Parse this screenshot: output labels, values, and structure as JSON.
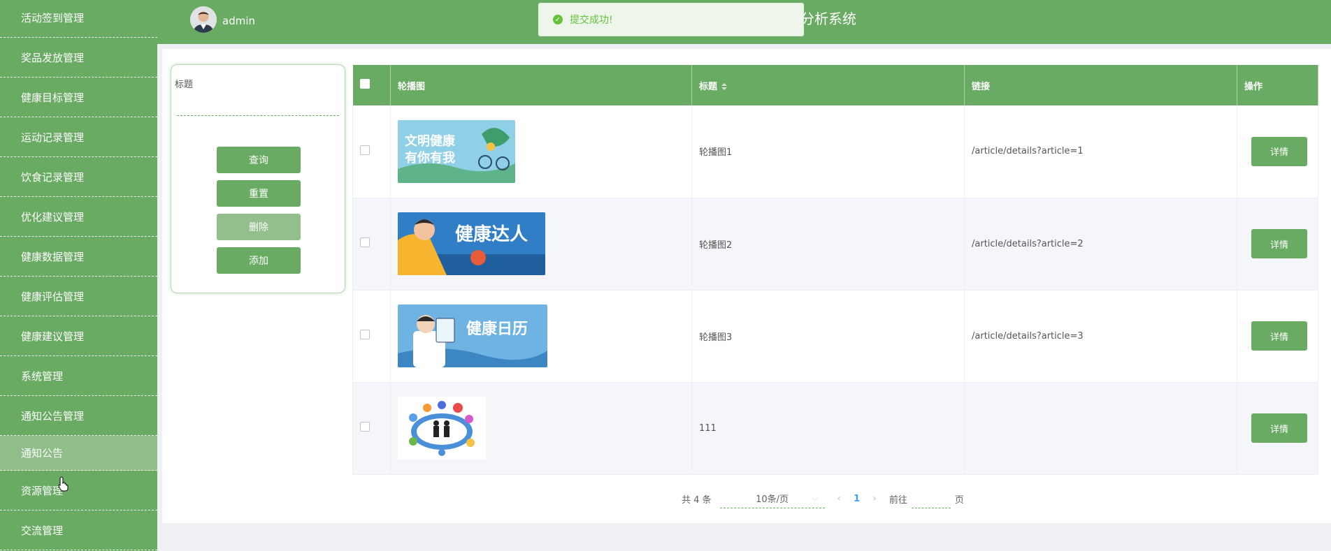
{
  "sidebar": {
    "items": [
      {
        "label": "活动签到管理"
      },
      {
        "label": "奖品发放管理"
      },
      {
        "label": "健康目标管理"
      },
      {
        "label": "运动记录管理"
      },
      {
        "label": "饮食记录管理"
      },
      {
        "label": "优化建议管理"
      },
      {
        "label": "健康数据管理"
      },
      {
        "label": "健康评估管理"
      },
      {
        "label": "健康建议管理"
      },
      {
        "label": "系统管理"
      },
      {
        "label": "通知公告管理"
      },
      {
        "label": "通知公告"
      },
      {
        "label": "资源管理"
      },
      {
        "label": "交流管理"
      }
    ],
    "active_index": 11
  },
  "header": {
    "username": "admin",
    "title_fragment": "分析系统"
  },
  "toast": {
    "message": "提交成功!"
  },
  "search": {
    "label": "标题",
    "value": "",
    "buttons": {
      "query": "查询",
      "reset": "重置",
      "delete": "删除",
      "add": "添加"
    }
  },
  "table": {
    "columns": [
      "轮播图",
      "标题",
      "链接",
      "操作"
    ],
    "rows": [
      {
        "title": "轮播图1",
        "link": "/article/details?article=1",
        "action": "详情",
        "image_caption": "文明健康 有你有我"
      },
      {
        "title": "轮播图2",
        "link": "/article/details?article=2",
        "action": "详情",
        "image_caption": "健康达人"
      },
      {
        "title": "轮播图3",
        "link": "/article/details?article=3",
        "action": "详情",
        "image_caption": "健康日历"
      },
      {
        "title": "111",
        "link": "",
        "action": "详情",
        "image_caption": ""
      }
    ]
  },
  "pagination": {
    "total_text": "共 4 条",
    "page_size": "10条/页",
    "current_page": "1",
    "goto_prefix": "前往",
    "goto_suffix": "页",
    "goto_value": ""
  },
  "colors": {
    "primary": "#6aab63",
    "active_menu": "#8fbe89",
    "success": "#67c23a",
    "page_active": "#409eff"
  }
}
